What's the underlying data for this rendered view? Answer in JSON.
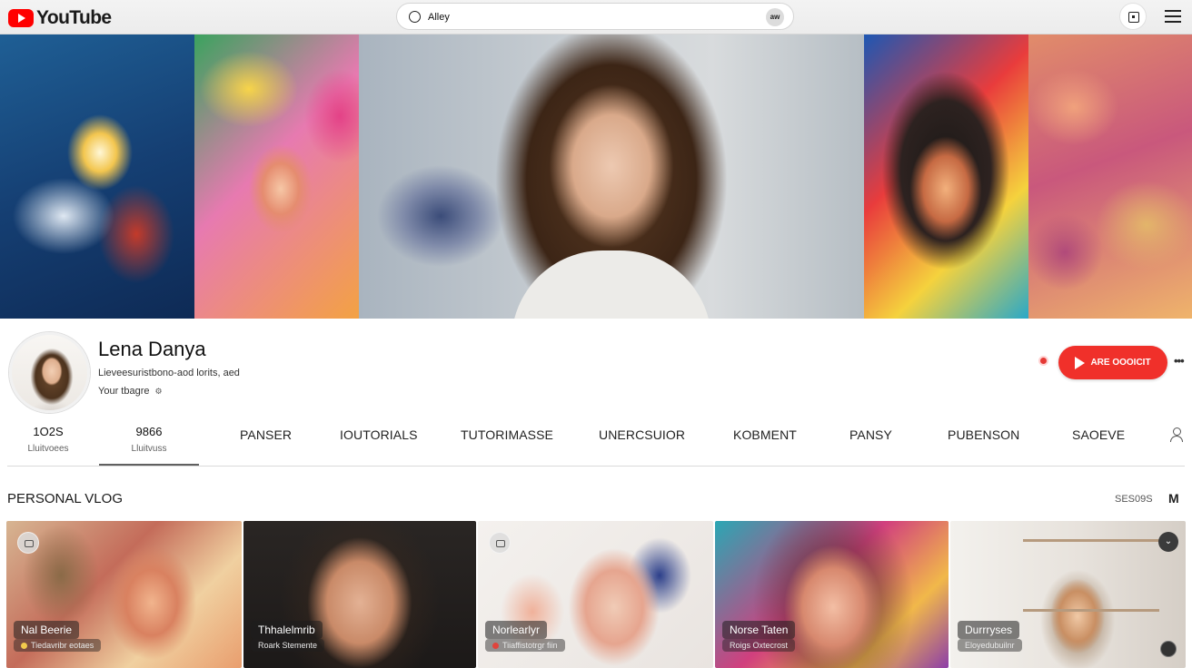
{
  "header": {
    "logo_text": "YouTube",
    "search_value": "Alley",
    "mic_label": "aw"
  },
  "channel": {
    "name": "Lena Danya",
    "description": "Lieveesuristbono-aod lorits, aed",
    "subline": "Your tbagre",
    "subscribe_label": "ARE OOOICIT",
    "more_label": "•••"
  },
  "tabs": {
    "stats": [
      {
        "number": "1O2S",
        "label": "Lluitvoees"
      },
      {
        "number": "9866",
        "label": "Lluitvuss"
      }
    ],
    "items": [
      "PANSER",
      "IOUTORIALS",
      "TUTORIMASSE",
      "UNERCSUIOR",
      "KOBMENT",
      "PANSY",
      "PUBENSON",
      "SAOEVE"
    ]
  },
  "section": {
    "title": "PERSONAL VLOG",
    "count": "SES09S",
    "corner_mark": "M"
  },
  "cards": [
    {
      "title": "Nal Beerie",
      "meta": "Tiedavribr eotaes"
    },
    {
      "title": "Thhalelmrib",
      "meta": "Roark Stemente"
    },
    {
      "title": "Norlearlyr",
      "meta": "Tiiaffistotrgr fiin"
    },
    {
      "title": "Norse Taten",
      "meta": "Roigs Oxtecrost"
    },
    {
      "title": "Durrryses",
      "meta": "Eloyedubuilnr"
    }
  ],
  "colors": {
    "brand_red": "#ff0000",
    "subscribe_red": "#f0302a"
  },
  "icons": {
    "search": "circle-search-icon",
    "calendar": "calendar-icon",
    "menu": "hamburger-menu-icon",
    "person": "person-icon"
  }
}
